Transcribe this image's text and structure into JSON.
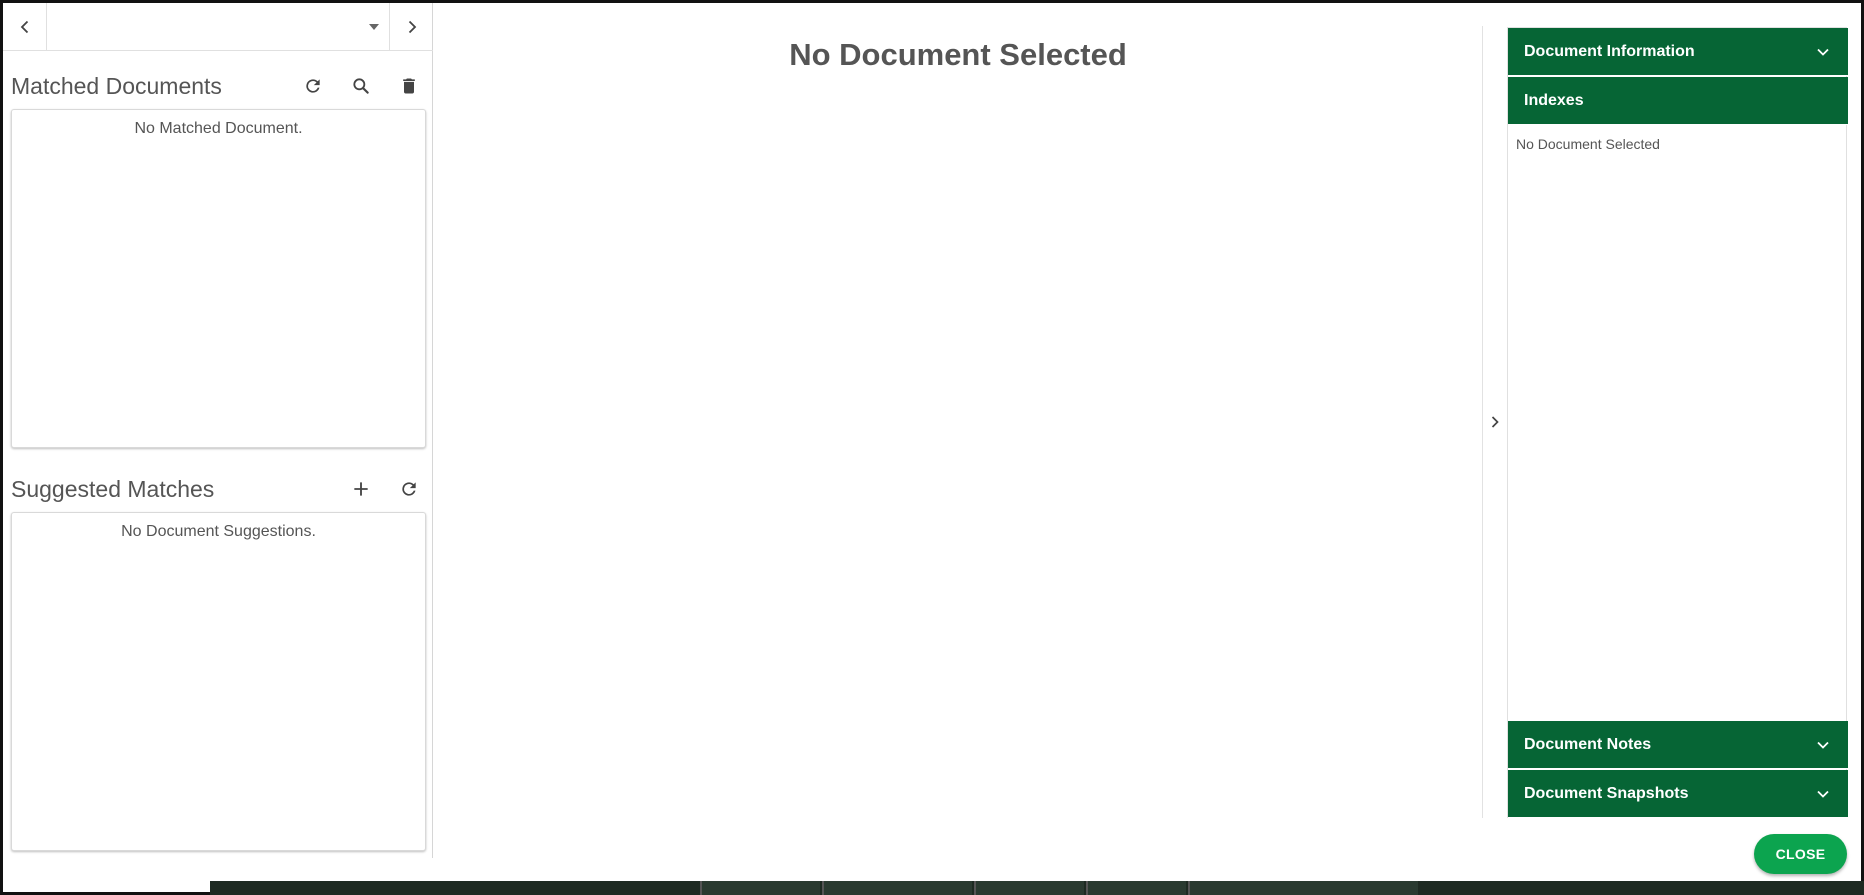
{
  "navigation": {
    "prev_icon": "chevron-left-icon",
    "next_icon": "chevron-right-icon",
    "document_select": {
      "value": "",
      "dropdown_icon": "caret-down-icon"
    }
  },
  "matched_documents": {
    "title": "Matched Documents",
    "icons": [
      "refresh-icon",
      "search-icon",
      "trash-icon"
    ],
    "empty_message": "No Matched Document."
  },
  "suggested_matches": {
    "title": "Suggested Matches",
    "icons": [
      "plus-icon",
      "refresh-icon"
    ],
    "empty_message": "No Document Suggestions."
  },
  "viewer": {
    "title": "No Document Selected"
  },
  "sidebar": {
    "sections": [
      {
        "label": "Document Information",
        "expanded": false
      },
      {
        "label": "Indexes",
        "expanded": true
      },
      {
        "label": "Document Notes",
        "expanded": false
      },
      {
        "label": "Document Snapshots",
        "expanded": false
      }
    ],
    "indexes_message": "No Document Selected"
  },
  "footer": {
    "close_label": "CLOSE"
  },
  "colors": {
    "header_green": "#066535",
    "close_green": "#0ca44f",
    "text_gray": "#555555"
  }
}
